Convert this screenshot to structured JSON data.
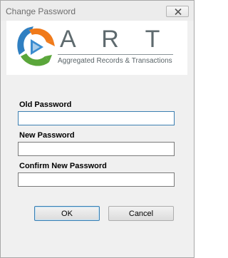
{
  "window": {
    "title": "Change Password"
  },
  "logo": {
    "wordmark": "A R T",
    "tagline": "Aggregated Records & Transactions"
  },
  "form": {
    "old_password": {
      "label": "Old Password",
      "value": ""
    },
    "new_password": {
      "label": "New Password",
      "value": ""
    },
    "confirm_password": {
      "label": "Confirm New Password",
      "value": ""
    }
  },
  "buttons": {
    "ok_label": "OK",
    "cancel_label": "Cancel"
  },
  "colors": {
    "logo_blue": "#2f7fc1",
    "logo_orange": "#f07a1a",
    "logo_green": "#5aa63a",
    "focus_border": "#3c7fb1"
  },
  "icons": {
    "close": "close-icon",
    "logo": "art-logo-icon"
  }
}
